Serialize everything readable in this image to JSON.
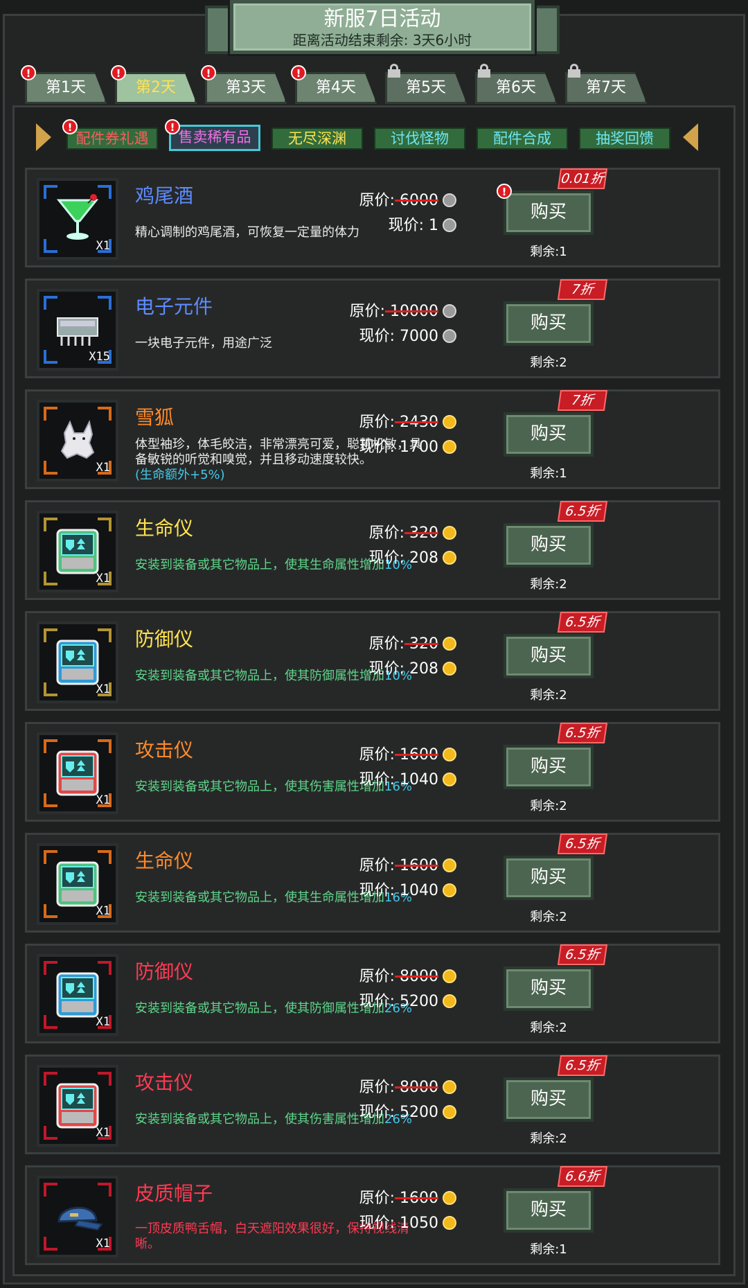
{
  "header": {
    "title": "新服7日活动",
    "countdown": "距离活动结束剩余: 3天6小时"
  },
  "days": [
    {
      "label": "第1天",
      "badge": "!",
      "locked": false
    },
    {
      "label": "第2天",
      "badge": "!",
      "locked": false,
      "active": true
    },
    {
      "label": "第3天",
      "badge": "!",
      "locked": false
    },
    {
      "label": "第4天",
      "badge": "!",
      "locked": false
    },
    {
      "label": "第5天",
      "locked": true
    },
    {
      "label": "第6天",
      "locked": true
    },
    {
      "label": "第7天",
      "locked": true
    }
  ],
  "categories": [
    {
      "label": "配件券礼遇",
      "color": "#ff5a5a",
      "badge": "!"
    },
    {
      "label": "售卖稀有品",
      "color": "#f06fe4",
      "badge": "!",
      "active": true
    },
    {
      "label": "无尽深渊",
      "color": "#ffe34f"
    },
    {
      "label": "讨伐怪物",
      "color": "#6fe6f2"
    },
    {
      "label": "配件合成",
      "color": "#6fe6f2"
    },
    {
      "label": "抽奖回馈",
      "color": "#6fe6f2"
    }
  ],
  "labels": {
    "orig": "原价:",
    "now": "现价:",
    "buy": "购买",
    "badge": "!"
  },
  "items": [
    {
      "name": "鸡尾酒",
      "name_color": "#5d8cff",
      "frame": "#2a6fd6",
      "icon": "cocktail-icon",
      "qty": "X1",
      "desc": "精心调制的鸡尾酒，可恢复一定量的体力",
      "desc_style": "white",
      "bonus": "",
      "orig": "6000",
      "now": "1",
      "currency": "silver",
      "discount": "0.01折",
      "remain": "剩余:1",
      "buy_badge": "!"
    },
    {
      "name": "电子元件",
      "name_color": "#5d8cff",
      "frame": "#2a6fd6",
      "icon": "chip-icon",
      "qty": "X15",
      "desc": "一块电子元件，用途广泛",
      "desc_style": "white",
      "bonus": "",
      "orig": "10000",
      "now": "7000",
      "currency": "silver",
      "discount": "7折",
      "remain": "剩余:2"
    },
    {
      "name": "雪狐",
      "name_color": "#ff8a2a",
      "frame": "#d86a1a",
      "icon": "fox-icon",
      "qty": "X1",
      "desc": "体型袖珍，体毛皎洁，非常漂亮可爱，聪慧机敏，具备敏锐的听觉和嗅觉，并且移动速度较快。",
      "desc_style": "white",
      "bonus": "(生命额外+5%)",
      "orig": "2430",
      "now": "1700",
      "currency": "gold",
      "discount": "7折",
      "remain": "剩余:1"
    },
    {
      "name": "生命仪",
      "name_color": "#ffe34f",
      "frame": "#b49332",
      "icon": "life-meter-icon",
      "qty": "X1",
      "desc": "安装到装备或其它物品上，使其生命属性增加",
      "desc_style": "green",
      "pct": "10%",
      "orig": "320",
      "now": "208",
      "currency": "gold",
      "discount": "6.5折",
      "remain": "剩余:2"
    },
    {
      "name": "防御仪",
      "name_color": "#ffe34f",
      "frame": "#b49332",
      "icon": "defense-meter-icon",
      "qty": "X1",
      "desc": "安装到装备或其它物品上，使其防御属性增加",
      "desc_style": "green",
      "pct": "10%",
      "orig": "320",
      "now": "208",
      "currency": "gold",
      "discount": "6.5折",
      "remain": "剩余:2"
    },
    {
      "name": "攻击仪",
      "name_color": "#ff8a2a",
      "frame": "#d86a1a",
      "icon": "attack-meter-icon",
      "qty": "X1",
      "desc": "安装到装备或其它物品上，使其伤害属性增加",
      "desc_style": "green",
      "pct": "16%",
      "orig": "1600",
      "now": "1040",
      "currency": "gold",
      "discount": "6.5折",
      "remain": "剩余:2"
    },
    {
      "name": "生命仪",
      "name_color": "#ff8a2a",
      "frame": "#d86a1a",
      "icon": "life-meter-icon",
      "qty": "X1",
      "desc": "安装到装备或其它物品上，使其生命属性增加",
      "desc_style": "green",
      "pct": "16%",
      "orig": "1600",
      "now": "1040",
      "currency": "gold",
      "discount": "6.5折",
      "remain": "剩余:2"
    },
    {
      "name": "防御仪",
      "name_color": "#ff3a52",
      "frame": "#c0182a",
      "icon": "defense-meter-icon",
      "qty": "X1",
      "desc": "安装到装备或其它物品上，使其防御属性增加",
      "desc_style": "green",
      "pct": "26%",
      "orig": "8000",
      "now": "5200",
      "currency": "gold",
      "discount": "6.5折",
      "remain": "剩余:2"
    },
    {
      "name": "攻击仪",
      "name_color": "#ff3a52",
      "frame": "#c0182a",
      "icon": "attack-meter-icon",
      "qty": "X1",
      "desc": "安装到装备或其它物品上，使其伤害属性增加",
      "desc_style": "green",
      "pct": "26%",
      "orig": "8000",
      "now": "5200",
      "currency": "gold",
      "discount": "6.5折",
      "remain": "剩余:2"
    },
    {
      "name": "皮质帽子",
      "name_color": "#ff3a52",
      "frame": "#c0182a",
      "icon": "cap-icon",
      "qty": "X1",
      "desc": "一顶皮质鸭舌帽，白天遮阳效果很好，保持视线清晰。",
      "desc_style": "red",
      "bonus": "",
      "orig": "1600",
      "now": "1050",
      "currency": "gold",
      "discount": "6.6折",
      "remain": "剩余:1"
    }
  ]
}
